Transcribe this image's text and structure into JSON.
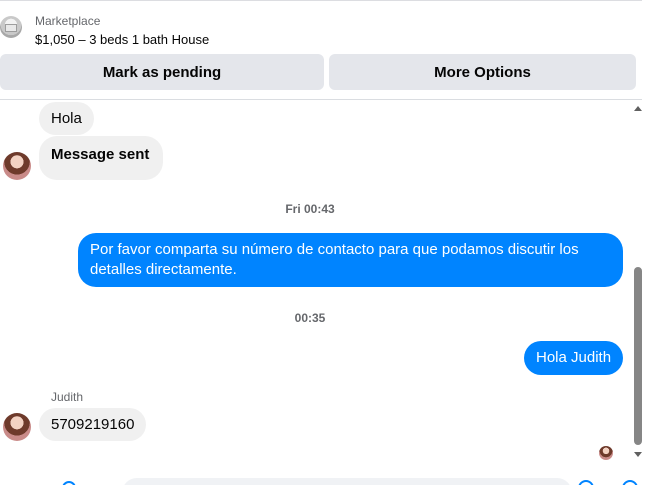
{
  "listing": {
    "source": "Marketplace",
    "title": "$1,050 – 3 beds 1 bath House"
  },
  "actions": {
    "pending_label": "Mark as pending",
    "more_label": "More Options"
  },
  "messages": {
    "in_1": "Hola",
    "in_2": "Message sent",
    "timestamp_1": "Fri 00:43",
    "out_1": "Por favor comparta su número de contacto para que podamos discutir los detalles directamente.",
    "timestamp_2": "00:35",
    "out_2": "Hola Judith",
    "sender_name": "Judith",
    "in_3": "5709219160"
  },
  "colors": {
    "outgoing_bubble": "#0084ff",
    "incoming_bubble": "#f0f0f0",
    "button_bg": "#e4e6eb"
  }
}
